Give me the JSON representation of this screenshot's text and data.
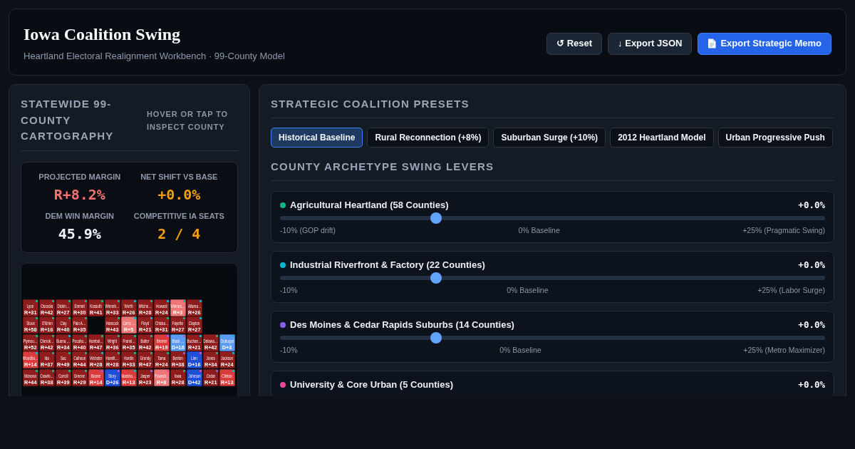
{
  "header": {
    "title": "Iowa Coalition Swing",
    "subtitle": "Heartland Electoral Realignment Workbench · 99-County Model",
    "buttons": [
      {
        "label": "↺ Reset",
        "kind": "secondary"
      },
      {
        "label": "↓ Export JSON",
        "kind": "secondary"
      },
      {
        "label": "Export Strategic Memo",
        "kind": "primary"
      }
    ]
  },
  "map_panel": {
    "title": "STATEWIDE 99-COUNTY CARTOGRAPHY",
    "hint": "HOVER OR TAP TO INSPECT COUNTY",
    "stats": [
      {
        "label": "PROJECTED MARGIN",
        "value": "R+8.2%",
        "color": "#f87171"
      },
      {
        "label": "NET SHIFT VS BASE",
        "value": "+0.0%",
        "color": "#f59e0b"
      },
      {
        "label": "DEM WIN MARGIN",
        "value": "45.9%",
        "color": "#f1f5f9"
      },
      {
        "label": "COMPETITIVE IA SEATS",
        "value": "2 / 4",
        "color": "#f59e0b"
      }
    ],
    "map": {
      "rows": [
        {
          "tiles": [
            {
              "kind": "county",
              "name": "Lyon",
              "margin": "R+31",
              "color": "#8f1d1d",
              "marker": {
                "color": "#10b981"
              }
            },
            {
              "kind": "county",
              "name": "Osceola",
              "margin": "R+42",
              "color": "#8f1d1d",
              "marker": {
                "color": "#10b981"
              }
            },
            {
              "kind": "county",
              "name": "Dickin…",
              "margin": "R+27",
              "color": "#8f1d1d",
              "marker": {
                "color": "#10b981"
              }
            },
            {
              "kind": "county",
              "name": "Emmet",
              "margin": "R+30",
              "color": "#8f1d1d",
              "marker": {
                "color": "#10b981"
              }
            },
            {
              "kind": "county",
              "name": "Kossuth",
              "margin": "R+41",
              "color": "#8f1d1d",
              "marker": {
                "color": "#10b981"
              }
            },
            {
              "kind": "county",
              "name": "Winneb…",
              "margin": "R+33",
              "color": "#8f1d1d",
              "marker": {
                "color": "#10b981"
              }
            },
            {
              "kind": "county",
              "name": "Worth",
              "margin": "R+26",
              "color": "#8f1d1d",
              "marker": {
                "color": "#06b6d4"
              }
            },
            {
              "kind": "county",
              "name": "Mitche…",
              "margin": "R+28",
              "color": "#8f1d1d",
              "marker": {
                "color": "#10b981"
              }
            },
            {
              "kind": "county",
              "name": "Howard",
              "margin": "R+24",
              "color": "#8f1d1d",
              "marker": {
                "color": "#06b6d4"
              }
            },
            {
              "kind": "county",
              "name": "Winnes…",
              "margin": "R+3",
              "color": "#ef7676",
              "marker": {
                "color": "#10b981"
              }
            },
            {
              "kind": "county",
              "name": "Allama…",
              "margin": "R+26",
              "color": "#8f1d1d",
              "marker": {
                "color": "#06b6d4"
              }
            }
          ]
        },
        {
          "tiles": [
            {
              "kind": "county",
              "name": "Sioux",
              "margin": "R+58",
              "color": "#8f1d1d",
              "marker": {
                "color": "#10b981"
              }
            },
            {
              "kind": "county",
              "name": "O'Brien",
              "margin": "R+16",
              "color": "#8f1d1d",
              "marker": {
                "color": "#10b981"
              }
            },
            {
              "kind": "county",
              "name": "Clay",
              "margin": "R+40",
              "color": "#8f1d1d",
              "marker": {
                "color": "#10b981"
              }
            },
            {
              "kind": "county",
              "name": "Palo A…",
              "margin": "R+35",
              "color": "#8f1d1d",
              "marker": {
                "color": "#10b981"
              }
            },
            {
              "kind": "gap"
            },
            {
              "kind": "county",
              "name": "Hancock",
              "margin": "R+43",
              "color": "#8f1d1d",
              "marker": {
                "color": "#10b981"
              }
            },
            {
              "kind": "county",
              "name": "Cerro …",
              "margin": "R+5",
              "color": "#ef7676",
              "marker": {
                "color": "#06b6d4"
              }
            },
            {
              "kind": "county",
              "name": "Floyd",
              "margin": "R+21",
              "color": "#8f1d1d",
              "marker": {
                "color": "#06b6d4"
              }
            },
            {
              "kind": "county",
              "name": "Chicka…",
              "margin": "R+31",
              "color": "#8f1d1d",
              "marker": {
                "color": "#10b981"
              }
            },
            {
              "kind": "county",
              "name": "Fayette",
              "margin": "R+27",
              "color": "#8f1d1d",
              "marker": {
                "color": "#10b981"
              }
            },
            {
              "kind": "county",
              "name": "Clayton",
              "margin": "R+27",
              "color": "#8f1d1d",
              "marker": {
                "color": "#06b6d4"
              }
            }
          ]
        },
        {
          "tiles": [
            {
              "kind": "county",
              "name": "Plymou…",
              "margin": "R+52",
              "color": "#8f1d1d",
              "marker": {
                "color": "#10b981"
              }
            },
            {
              "kind": "county",
              "name": "Cherok…",
              "margin": "R+42",
              "color": "#8f1d1d",
              "marker": {
                "color": "#10b981"
              }
            },
            {
              "kind": "county",
              "name": "Buena …",
              "margin": "R+34",
              "color": "#8f1d1d",
              "marker": {
                "color": "#06b6d4"
              }
            },
            {
              "kind": "county",
              "name": "Pocaho…",
              "margin": "R+40",
              "color": "#8f1d1d",
              "marker": {
                "color": "#10b981"
              }
            },
            {
              "kind": "county",
              "name": "Humbol…",
              "margin": "R+47",
              "color": "#8f1d1d",
              "marker": {
                "color": "#10b981"
              }
            },
            {
              "kind": "county",
              "name": "Wright",
              "margin": "R+36",
              "color": "#8f1d1d",
              "marker": {
                "color": "#10b981"
              }
            },
            {
              "kind": "county",
              "name": "Frankl…",
              "margin": "R+35",
              "color": "#8f1d1d",
              "marker": {
                "color": "#10b981"
              }
            },
            {
              "kind": "county",
              "name": "Butler",
              "margin": "R+42",
              "color": "#8f1d1d",
              "marker": {
                "color": "#10b981"
              }
            },
            {
              "kind": "county",
              "name": "Bremer",
              "margin": "R+19",
              "color": "#dc3b3b",
              "marker": {
                "color": "#8b5cf6"
              }
            },
            {
              "kind": "county",
              "name": "Black …",
              "margin": "D+18",
              "color": "#5b9cf2",
              "marker": {
                "color": "#ec4899"
              }
            },
            {
              "kind": "county",
              "name": "Buchan…",
              "margin": "R+21",
              "color": "#8f1d1d",
              "marker": {
                "color": "#06b6d4"
              }
            },
            {
              "kind": "county",
              "name": "Delawa…",
              "margin": "R+42",
              "color": "#8f1d1d",
              "marker": {
                "color": "#10b981"
              }
            },
            {
              "kind": "county",
              "name": "Dubuque",
              "margin": "D+3",
              "color": "#5b9cf2",
              "marker": {
                "color": "#06b6d4"
              }
            }
          ]
        },
        {
          "tiles": [
            {
              "kind": "county",
              "name": "Woodbu…",
              "margin": "R+14",
              "color": "#dc3b3b",
              "marker": {
                "color": "#06b6d4"
              }
            },
            {
              "kind": "county",
              "name": "Ida",
              "margin": "R+37",
              "color": "#8f1d1d",
              "marker": {
                "color": "#10b981"
              }
            },
            {
              "kind": "county",
              "name": "Sac",
              "margin": "R+49",
              "color": "#8f1d1d",
              "marker": {
                "color": "#10b981"
              }
            },
            {
              "kind": "county",
              "name": "Calhoun",
              "margin": "R+44",
              "color": "#8f1d1d",
              "marker": {
                "color": "#10b981"
              }
            },
            {
              "kind": "county",
              "name": "Webster",
              "margin": "R+28",
              "color": "#8f1d1d",
              "marker": {
                "color": "#06b6d4"
              }
            },
            {
              "kind": "county",
              "name": "Hamilt…",
              "margin": "R+28",
              "color": "#8f1d1d",
              "marker": {
                "color": "#10b981"
              }
            },
            {
              "kind": "county",
              "name": "Hardin",
              "margin": "R+33",
              "color": "#8f1d1d",
              "marker": {
                "color": "#10b981"
              }
            },
            {
              "kind": "county",
              "name": "Grundy",
              "margin": "R+47",
              "color": "#8f1d1d",
              "marker": {
                "color": "#10b981"
              }
            },
            {
              "kind": "county",
              "name": "Tama",
              "margin": "R+24",
              "color": "#8f1d1d",
              "marker": {
                "color": "#10b981"
              }
            },
            {
              "kind": "county",
              "name": "Benton",
              "margin": "R+38",
              "color": "#8f1d1d",
              "marker": {
                "color": "#8b5cf6"
              }
            },
            {
              "kind": "county",
              "name": "Linn",
              "margin": "D+16",
              "color": "#1d4fd8",
              "marker": {
                "color": "#ec4899"
              }
            },
            {
              "kind": "county",
              "name": "Jones",
              "margin": "R+34",
              "color": "#8f1d1d",
              "marker": {
                "color": "#10b981"
              }
            },
            {
              "kind": "county",
              "name": "Jackson",
              "margin": "R+24",
              "color": "#8f1d1d",
              "marker": {
                "color": "#06b6d4"
              }
            }
          ]
        },
        {
          "tiles": [
            {
              "kind": "county",
              "name": "Monona",
              "margin": "R+44",
              "color": "#8f1d1d",
              "marker": {
                "color": "#10b981"
              }
            },
            {
              "kind": "county",
              "name": "Crawfo…",
              "margin": "R+38",
              "color": "#8f1d1d",
              "marker": {
                "color": "#10b981"
              }
            },
            {
              "kind": "county",
              "name": "Carroll",
              "margin": "R+39",
              "color": "#8f1d1d",
              "marker": {
                "color": "#10b981"
              }
            },
            {
              "kind": "county",
              "name": "Greene",
              "margin": "R+29",
              "color": "#8f1d1d",
              "marker": {
                "color": "#10b981"
              }
            },
            {
              "kind": "county",
              "name": "Boone",
              "margin": "R+14",
              "color": "#dc3b3b",
              "marker": {
                "color": "#8b5cf6"
              }
            },
            {
              "kind": "county",
              "name": "Story",
              "margin": "D+26",
              "color": "#1d4fd8",
              "marker": {
                "color": "#ec4899"
              }
            },
            {
              "kind": "county",
              "name": "Marsha…",
              "margin": "R+13",
              "color": "#dc3b3b",
              "marker": {
                "color": "#06b6d4"
              }
            },
            {
              "kind": "county",
              "name": "Jasper",
              "margin": "R+23",
              "color": "#8f1d1d",
              "marker": {
                "color": "#8b5cf6"
              }
            },
            {
              "kind": "county",
              "name": "Powesh…",
              "margin": "R+8",
              "color": "#ef7676",
              "marker": {
                "color": "#ec4899"
              }
            },
            {
              "kind": "county",
              "name": "Iowa",
              "margin": "R+28",
              "color": "#8f1d1d",
              "marker": {
                "color": "#10b981"
              }
            },
            {
              "kind": "county",
              "name": "Johnson",
              "margin": "D+42",
              "color": "#1d4fd8",
              "marker": {
                "color": "#ec4899"
              }
            },
            {
              "kind": "county",
              "name": "Cedar",
              "margin": "R+21",
              "color": "#8f1d1d",
              "marker": {
                "color": "#8b5cf6"
              }
            },
            {
              "kind": "county",
              "name": "Clinton",
              "margin": "R+13",
              "color": "#dc3b3b",
              "marker": {
                "color": "#06b6d4"
              }
            }
          ]
        }
      ]
    }
  },
  "presets_panel": {
    "title": "STRATEGIC COALITION PRESETS",
    "presets": [
      {
        "label": "Historical Baseline",
        "selected": true
      },
      {
        "label": "Rural Reconnection (+8%)",
        "selected": false
      },
      {
        "label": "Suburban Surge (+10%)",
        "selected": false
      },
      {
        "label": "2012 Heartland Model",
        "selected": false
      },
      {
        "label": "Urban Progressive Push",
        "selected": false
      }
    ],
    "levers_title": "COUNTY ARCHETYPE SWING LEVERS",
    "levers": [
      {
        "name": "Agricultural Heartland (58 Counties)",
        "color": "#10b981",
        "value": "+0.0%",
        "level": 0.286,
        "min_label": "-10% (GOP drift)",
        "mid_label": "0% Baseline",
        "max_label": "+25% (Pragmatic Swing)"
      },
      {
        "name": "Industrial Riverfront & Factory (22 Counties)",
        "color": "#06b6d4",
        "value": "+0.0%",
        "level": 0.286,
        "min_label": "-10%",
        "mid_label": "0% Baseline",
        "max_label": "+25% (Labor Surge)"
      },
      {
        "name": "Des Moines & Cedar Rapids Suburbs (14 Counties)",
        "color": "#8b5cf6",
        "value": "+0.0%",
        "level": 0.286,
        "min_label": "-10%",
        "mid_label": "0% Baseline",
        "max_label": "+25% (Metro Maximizer)"
      },
      {
        "name": "University & Core Urban (5 Counties)",
        "color": "#ec4899",
        "value": "+0.0%"
      }
    ]
  }
}
